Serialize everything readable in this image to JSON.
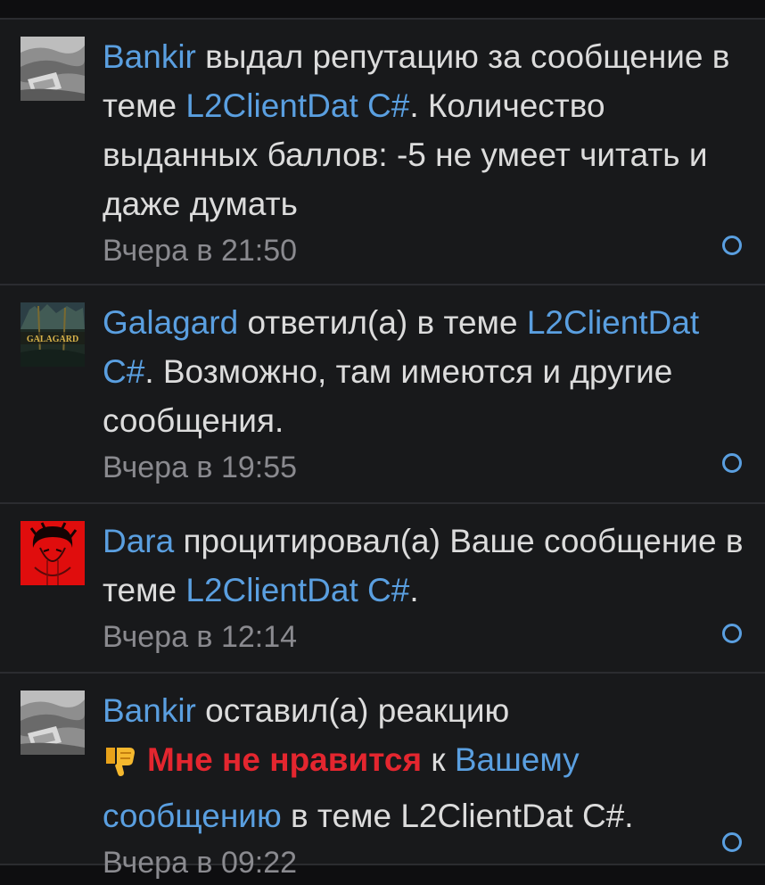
{
  "alerts": [
    {
      "avatar_icon": "bankir-avatar",
      "user": "Bankir",
      "t1": " выдал репутацию за сообщение в теме ",
      "thread": "L2ClientDat C#",
      "t2": ". Количество выданных баллов: -5 не умеет читать и даже думать",
      "time": "Вчера в 21:50"
    },
    {
      "avatar_icon": "galagard-avatar",
      "avatar_text": "GALAGARD",
      "user": "Galagard",
      "t1": " ответил(а) в теме ",
      "thread": "L2ClientDat C#",
      "t2": ". Возможно, там имеются и другие сообщения.",
      "time": "Вчера в 19:55"
    },
    {
      "avatar_icon": "dara-avatar",
      "user": "Dara",
      "t1": " процитировал(а) Ваше сообщение в теме ",
      "thread": "L2ClientDat C#",
      "t2": ".",
      "time": "Вчера в 12:14"
    },
    {
      "avatar_icon": "bankir-avatar",
      "user": "Bankir",
      "t1": " оставил(а) реакцию ",
      "reaction_icon": "thumbs-down-emoji",
      "reaction": "Мне не нравится",
      "t2": " к ",
      "post_link": "Вашему сообщению",
      "t3": " в теме L2ClientDat C#.",
      "time": "Вчера в 09:22"
    }
  ],
  "colors": {
    "background": "#0e0e10",
    "card": "#18191b",
    "link": "#5a9fe0",
    "text": "#dcdcdc",
    "muted": "#8a8a8f",
    "reaction": "#e4262f"
  }
}
